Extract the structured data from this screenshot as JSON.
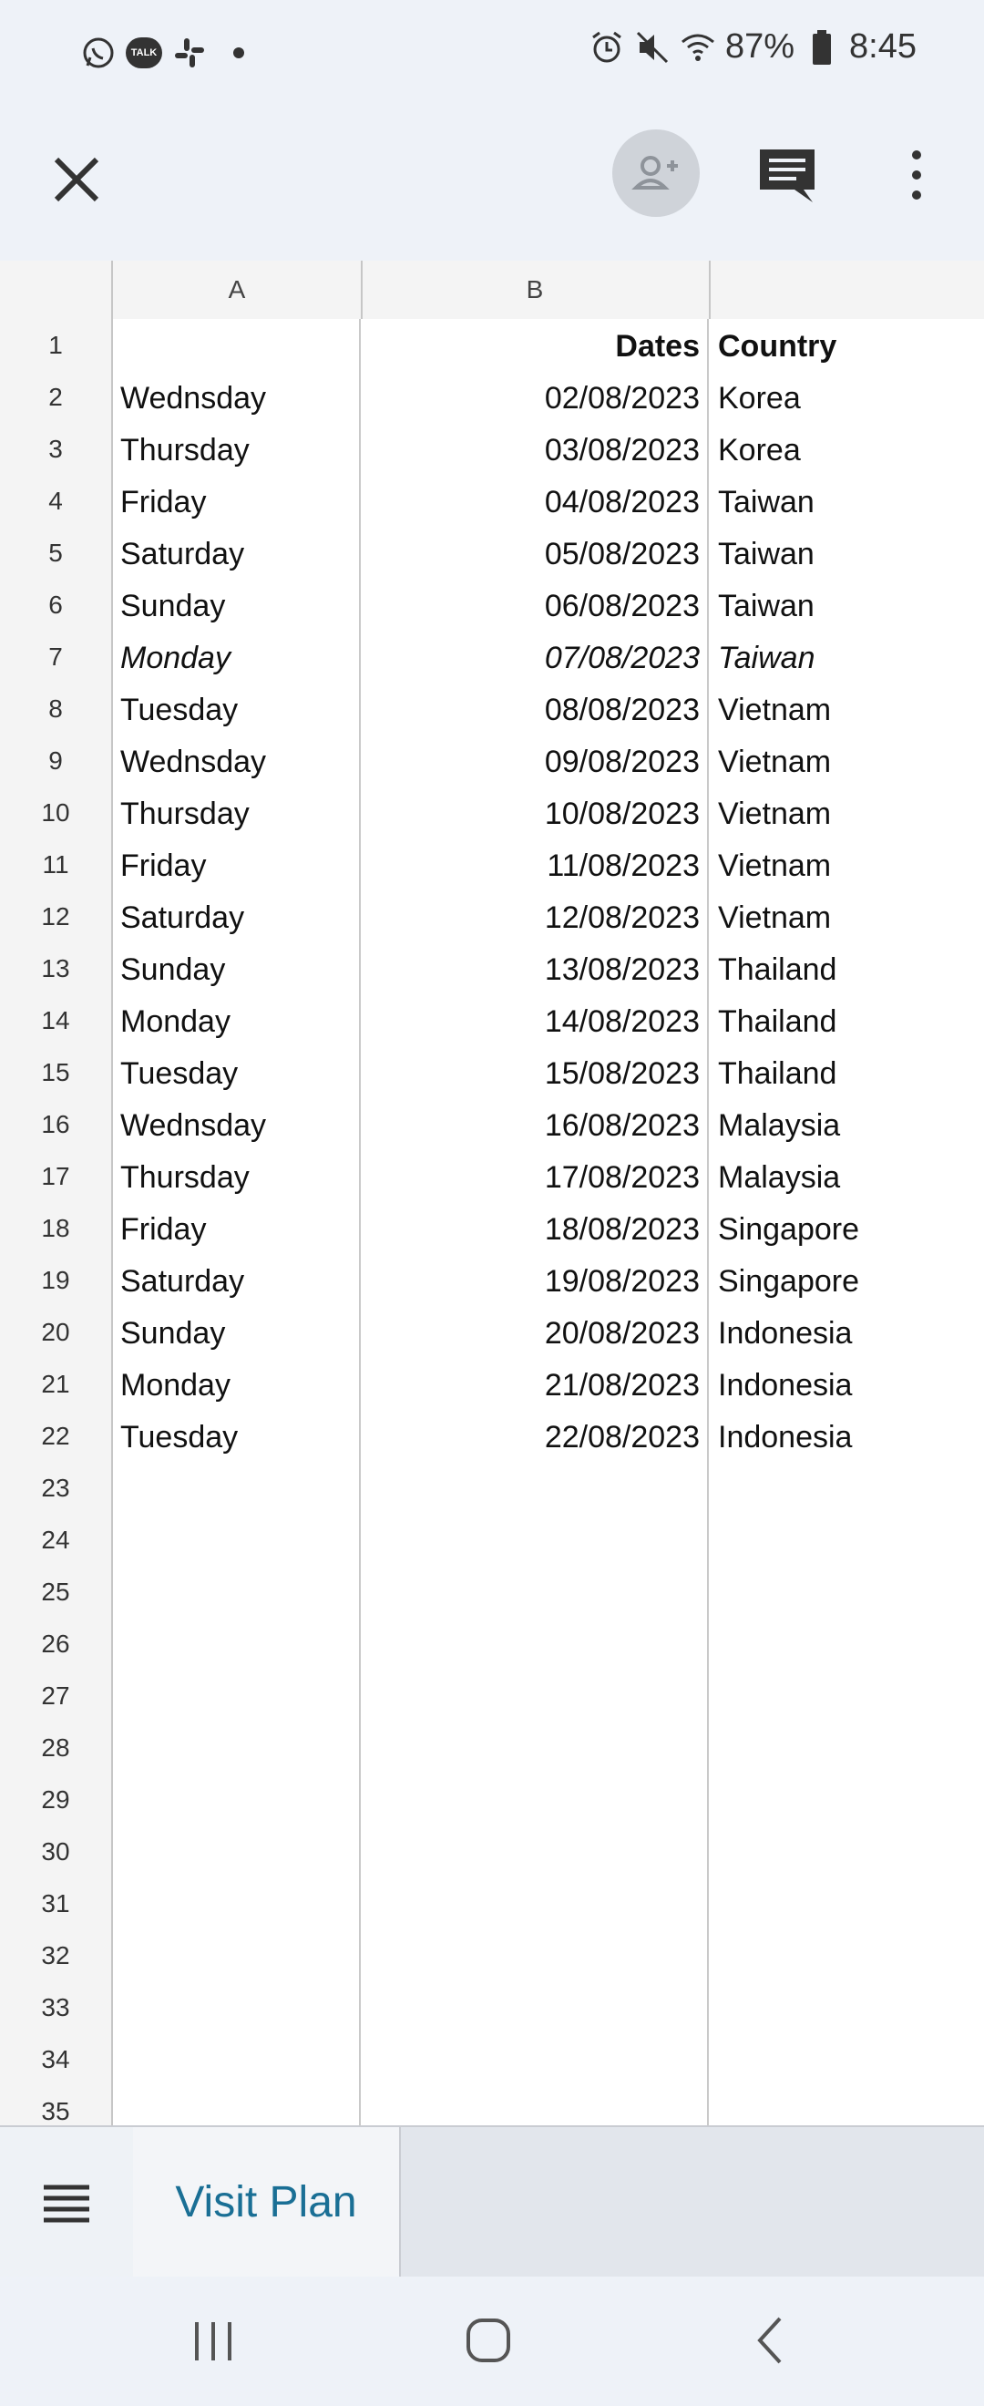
{
  "status_bar": {
    "battery": "87%",
    "time": "8:45",
    "icons": [
      "whatsapp-icon",
      "kakaotalk-icon",
      "slack-icon",
      "dot-icon",
      "alarm-icon",
      "mute-icon",
      "wifi-icon",
      "battery-icon"
    ],
    "talk_badge": "TALK"
  },
  "app_bar": {
    "icons": [
      "close-icon",
      "add-person-icon",
      "comment-icon",
      "more-vert-icon"
    ]
  },
  "sheet": {
    "columns": [
      "A",
      "B",
      ""
    ],
    "rows": [
      {
        "n": "1",
        "a": "",
        "b": "Dates",
        "c": "Country",
        "style": "header"
      },
      {
        "n": "2",
        "a": "Wednsday",
        "b": "02/08/2023",
        "c": "Korea"
      },
      {
        "n": "3",
        "a": "Thursday",
        "b": "03/08/2023",
        "c": "Korea"
      },
      {
        "n": "4",
        "a": "Friday",
        "b": "04/08/2023",
        "c": "Taiwan"
      },
      {
        "n": "5",
        "a": "Saturday",
        "b": "05/08/2023",
        "c": "Taiwan"
      },
      {
        "n": "6",
        "a": "Sunday",
        "b": "06/08/2023",
        "c": "Taiwan"
      },
      {
        "n": "7",
        "a": "Monday",
        "b": "07/08/2023",
        "c": "Taiwan",
        "style": "italic"
      },
      {
        "n": "8",
        "a": "Tuesday",
        "b": "08/08/2023",
        "c": "Vietnam"
      },
      {
        "n": "9",
        "a": "Wednsday",
        "b": "09/08/2023",
        "c": "Vietnam"
      },
      {
        "n": "10",
        "a": "Thursday",
        "b": "10/08/2023",
        "c": "Vietnam"
      },
      {
        "n": "11",
        "a": "Friday",
        "b": "11/08/2023",
        "c": "Vietnam"
      },
      {
        "n": "12",
        "a": "Saturday",
        "b": "12/08/2023",
        "c": "Vietnam"
      },
      {
        "n": "13",
        "a": "Sunday",
        "b": "13/08/2023",
        "c": "Thailand"
      },
      {
        "n": "14",
        "a": "Monday",
        "b": "14/08/2023",
        "c": "Thailand"
      },
      {
        "n": "15",
        "a": "Tuesday",
        "b": "15/08/2023",
        "c": "Thailand"
      },
      {
        "n": "16",
        "a": "Wednsday",
        "b": "16/08/2023",
        "c": "Malaysia"
      },
      {
        "n": "17",
        "a": "Thursday",
        "b": "17/08/2023",
        "c": "Malaysia"
      },
      {
        "n": "18",
        "a": "Friday",
        "b": "18/08/2023",
        "c": "Singapore"
      },
      {
        "n": "19",
        "a": "Saturday",
        "b": "19/08/2023",
        "c": "Singapore"
      },
      {
        "n": "20",
        "a": "Sunday",
        "b": "20/08/2023",
        "c": "Indonesia"
      },
      {
        "n": "21",
        "a": "Monday",
        "b": "21/08/2023",
        "c": "Indonesia"
      },
      {
        "n": "22",
        "a": "Tuesday",
        "b": "22/08/2023",
        "c": "Indonesia"
      },
      {
        "n": "23",
        "a": "",
        "b": "",
        "c": ""
      },
      {
        "n": "24",
        "a": "",
        "b": "",
        "c": ""
      },
      {
        "n": "25",
        "a": "",
        "b": "",
        "c": ""
      },
      {
        "n": "26",
        "a": "",
        "b": "",
        "c": ""
      },
      {
        "n": "27",
        "a": "",
        "b": "",
        "c": ""
      },
      {
        "n": "28",
        "a": "",
        "b": "",
        "c": ""
      },
      {
        "n": "29",
        "a": "",
        "b": "",
        "c": ""
      },
      {
        "n": "30",
        "a": "",
        "b": "",
        "c": ""
      },
      {
        "n": "31",
        "a": "",
        "b": "",
        "c": ""
      },
      {
        "n": "32",
        "a": "",
        "b": "",
        "c": ""
      },
      {
        "n": "33",
        "a": "",
        "b": "",
        "c": ""
      },
      {
        "n": "34",
        "a": "",
        "b": "",
        "c": ""
      },
      {
        "n": "35",
        "a": "",
        "b": "",
        "c": ""
      }
    ]
  },
  "tabs": {
    "menu_icon": "sheet-list-icon",
    "active_tab": "Visit Plan"
  },
  "nav_bar": {
    "icons": [
      "recents-icon",
      "home-icon",
      "back-icon"
    ]
  },
  "colors": {
    "background": "#eef2f8",
    "tab_text": "#1a6f95"
  }
}
